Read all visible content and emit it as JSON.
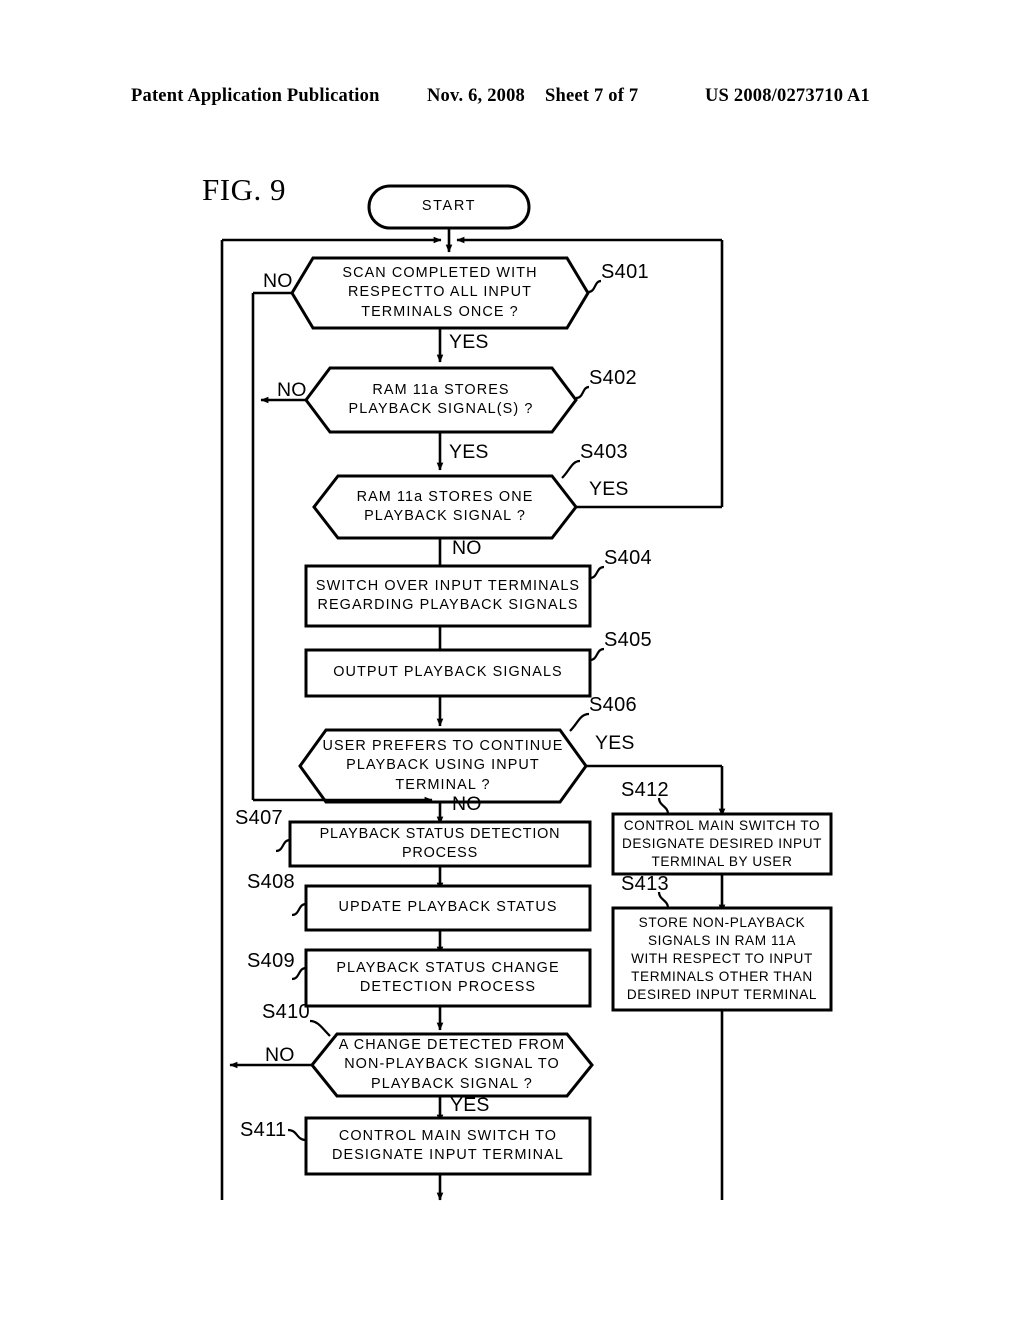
{
  "header": {
    "publication": "Patent Application Publication",
    "date": "Nov. 6, 2008",
    "sheet": "Sheet 7 of 7",
    "number": "US 2008/0273710 A1"
  },
  "figure": {
    "label": "FIG. 9"
  },
  "flowchart": {
    "start": {
      "label": "START"
    },
    "nodes": [
      {
        "id": "S401",
        "ref": "S401",
        "shape": "decision",
        "text": "SCAN COMPLETED WITH\nRESPECTTO ALL INPUT\nTERMINALS ONCE ?"
      },
      {
        "id": "S402",
        "ref": "S402",
        "shape": "decision",
        "text": "RAM 11a STORES\nPLAYBACK SIGNAL(S) ?"
      },
      {
        "id": "S403",
        "ref": "S403",
        "shape": "decision",
        "text": "RAM 11a STORES ONE\nPLAYBACK SIGNAL ?"
      },
      {
        "id": "S404",
        "ref": "S404",
        "shape": "process",
        "text": "SWITCH OVER INPUT TERMINALS\nREGARDING PLAYBACK SIGNALS"
      },
      {
        "id": "S405",
        "ref": "S405",
        "shape": "process",
        "text": "OUTPUT PLAYBACK SIGNALS"
      },
      {
        "id": "S406",
        "ref": "S406",
        "shape": "decision",
        "text": "USER PREFERS TO CONTINUE\nPLAYBACK USING INPUT\nTERMINAL ?"
      },
      {
        "id": "S407",
        "ref": "S407",
        "shape": "process",
        "text": "PLAYBACK STATUS DETECTION PROCESS"
      },
      {
        "id": "S408",
        "ref": "S408",
        "shape": "process",
        "text": "UPDATE PLAYBACK STATUS"
      },
      {
        "id": "S409",
        "ref": "S409",
        "shape": "process",
        "text": "PLAYBACK STATUS CHANGE\nDETECTION PROCESS"
      },
      {
        "id": "S410",
        "ref": "S410",
        "shape": "decision",
        "text": "A CHANGE DETECTED FROM\nNON-PLAYBACK SIGNAL TO\nPLAYBACK SIGNAL ?"
      },
      {
        "id": "S411",
        "ref": "S411",
        "shape": "process",
        "text": "CONTROL MAIN SWITCH TO\nDESIGNATE INPUT TERMINAL"
      },
      {
        "id": "S412",
        "ref": "S412",
        "shape": "process",
        "text": "CONTROL MAIN SWITCH TO\nDESIGNATE DESIRED INPUT\nTERMINAL BY USER"
      },
      {
        "id": "S413",
        "ref": "S413",
        "shape": "process",
        "text": "STORE NON-PLAYBACK\nSIGNALS IN RAM 11A\nWITH RESPECT TO INPUT\nTERMINALS OTHER THAN\nDESIRED INPUT TERMINAL"
      }
    ],
    "branch_labels": [
      {
        "id": "s401-no",
        "text": "NO"
      },
      {
        "id": "s401-yes",
        "text": "YES"
      },
      {
        "id": "s402-no",
        "text": "NO"
      },
      {
        "id": "s402-yes",
        "text": "YES"
      },
      {
        "id": "s403-yes",
        "text": "YES"
      },
      {
        "id": "s403-no",
        "text": "NO"
      },
      {
        "id": "s406-yes",
        "text": "YES"
      },
      {
        "id": "s406-no",
        "text": "NO"
      },
      {
        "id": "s410-no",
        "text": "NO"
      },
      {
        "id": "s410-yes",
        "text": "YES"
      }
    ]
  }
}
